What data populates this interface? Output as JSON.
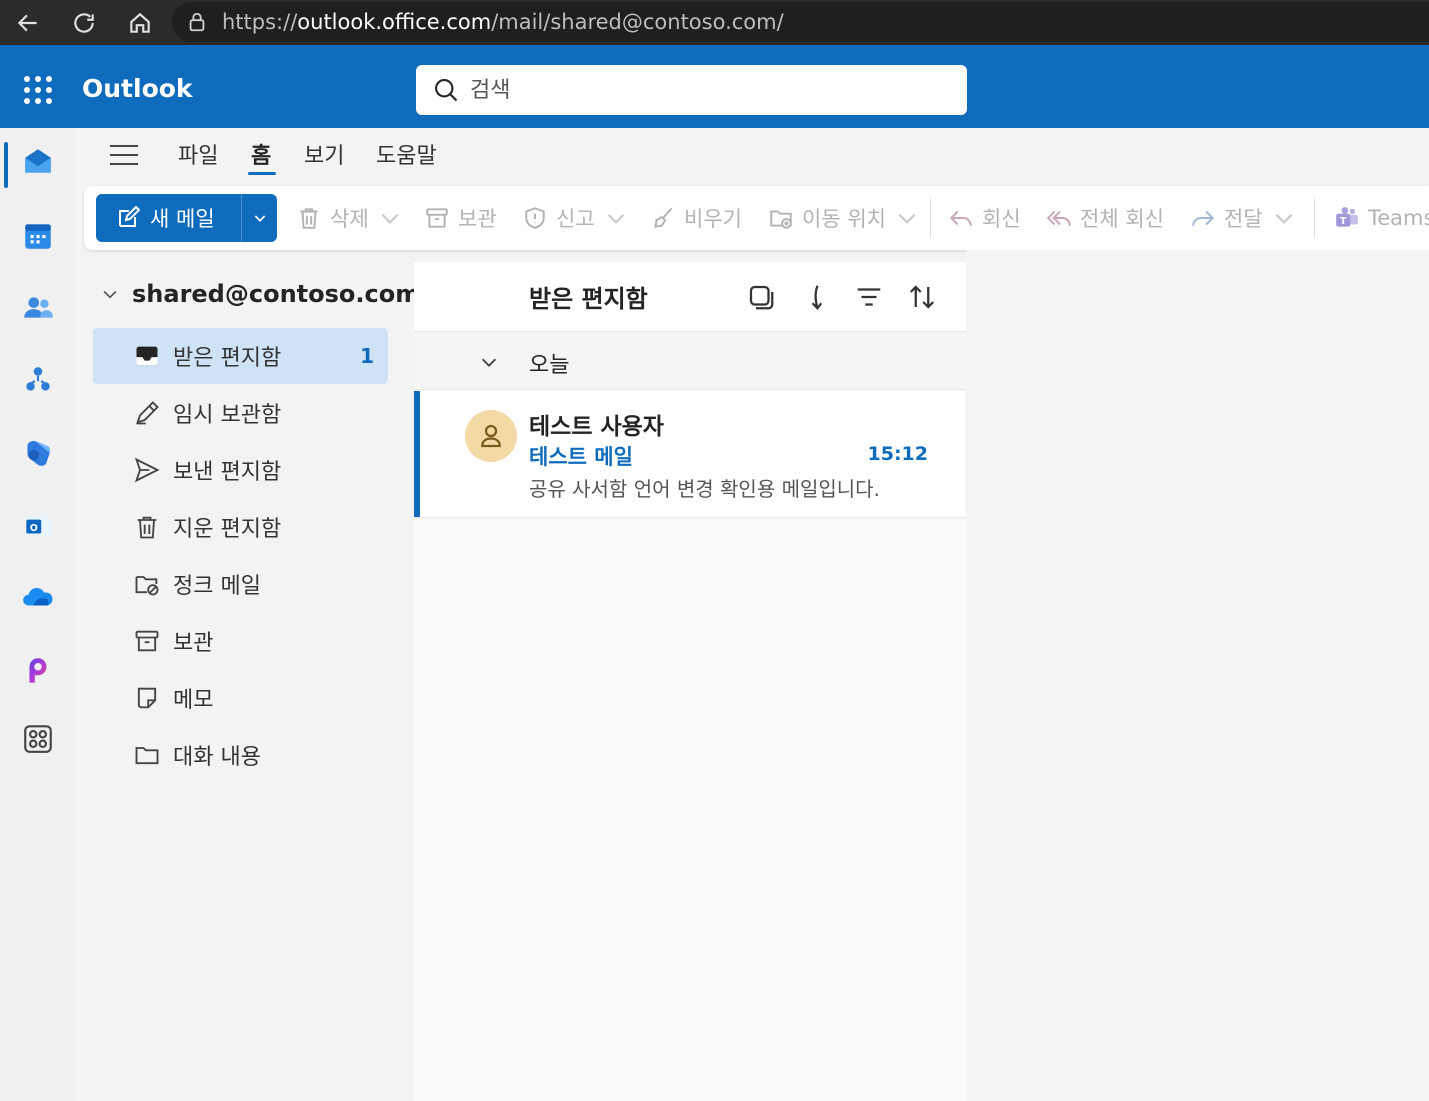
{
  "browser": {
    "url_scheme": "https://",
    "url_host": "outlook.office.com",
    "url_path": "/mail/shared@contoso.com/"
  },
  "header": {
    "app_title": "Outlook",
    "search_placeholder": "검색"
  },
  "ribbon": {
    "tabs": [
      "파일",
      "홈",
      "보기",
      "도움말"
    ],
    "active_tab": "홈",
    "new_mail_label": "새 메일",
    "delete_label": "삭제",
    "archive_label": "보관",
    "report_label": "신고",
    "sweep_label": "비우기",
    "move_label": "이동 위치",
    "reply_label": "회신",
    "reply_all_label": "전체 회신",
    "forward_label": "전달",
    "teams_label": "Teams"
  },
  "folder_pane": {
    "account": "shared@contoso.com",
    "folders": [
      {
        "name": "받은 편지함",
        "icon": "inbox-icon",
        "count": "1",
        "selected": true
      },
      {
        "name": "임시 보관함",
        "icon": "drafts-icon"
      },
      {
        "name": "보낸 편지함",
        "icon": "send-icon"
      },
      {
        "name": "지운 편지함",
        "icon": "trash-icon"
      },
      {
        "name": "정크 메일",
        "icon": "junk-icon"
      },
      {
        "name": "보관",
        "icon": "archive-icon"
      },
      {
        "name": "메모",
        "icon": "note-icon"
      },
      {
        "name": "대화 내용",
        "icon": "folder-icon"
      }
    ]
  },
  "message_list": {
    "title": "받은 편지함",
    "group_label": "오늘",
    "messages": [
      {
        "sender": "테스트 사용자",
        "subject": "테스트 메일",
        "time": "15:12",
        "preview": "공유 사서함 언어 변경 확인용 메일입니다."
      }
    ]
  },
  "colors": {
    "brand": "#0f6cbd",
    "selected_folder": "#cfe3f7",
    "avatar": "#f3d9a4"
  }
}
